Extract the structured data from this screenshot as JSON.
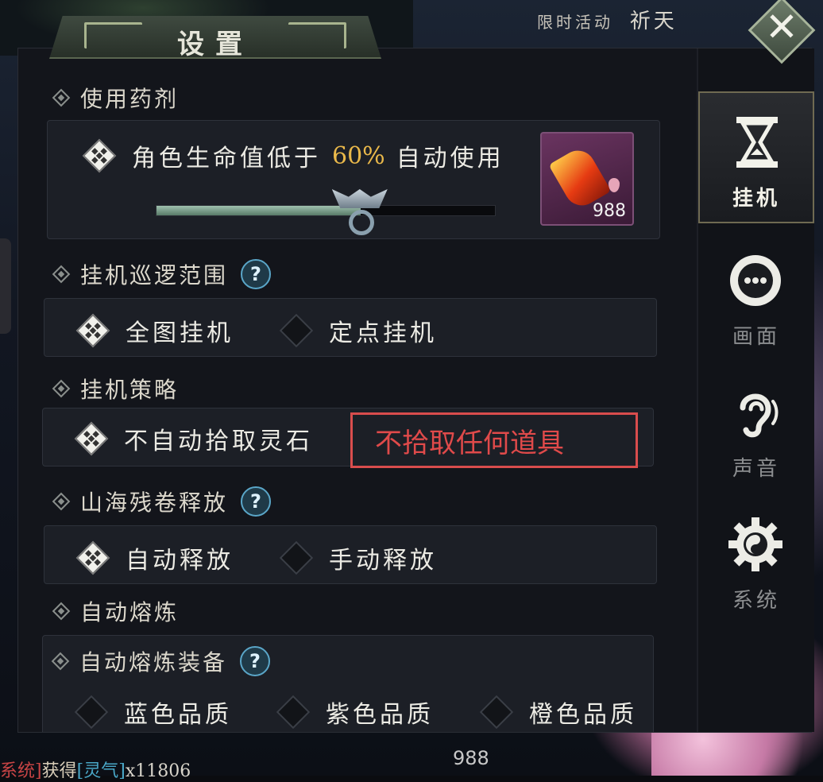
{
  "hud": {
    "label1": "限时活动",
    "label2": "祈天"
  },
  "window": {
    "title": "设置"
  },
  "close": {
    "glyph": "✕"
  },
  "sections": {
    "potion": {
      "header": "使用药剂",
      "label_prefix": "角色生命值低于",
      "percent": "60%",
      "label_suffix": "自动使用",
      "slider_value": 0.6,
      "item_count": "988"
    },
    "patrol": {
      "header": "挂机巡逻范围",
      "help": "?",
      "options": [
        {
          "label": "全图挂机",
          "selected": true
        },
        {
          "label": "定点挂机",
          "selected": false
        }
      ]
    },
    "strategy": {
      "header": "挂机策略",
      "option": {
        "label": "不自动拾取灵石",
        "selected": true
      },
      "annotation": "不拾取任何道具"
    },
    "scroll": {
      "header": "山海残卷释放",
      "help": "?",
      "options": [
        {
          "label": "自动释放",
          "selected": true
        },
        {
          "label": "手动释放",
          "selected": false
        }
      ]
    },
    "smelt": {
      "header": "自动熔炼",
      "sub_header": "自动熔炼装备",
      "help": "?",
      "options_partial": [
        "蓝色品质",
        "紫色品质",
        "橙色品质"
      ]
    }
  },
  "sidebar": {
    "tabs": [
      {
        "label": "挂机",
        "icon": "hourglass-icon",
        "active": true
      },
      {
        "label": "画面",
        "icon": "display-icon",
        "active": false
      },
      {
        "label": "声音",
        "icon": "ear-icon",
        "active": false
      },
      {
        "label": "系统",
        "icon": "gear-icon",
        "active": false
      }
    ]
  },
  "chat": {
    "channel": "系统",
    "verb": "获得",
    "item": "灵气",
    "amount": "x11806"
  },
  "bottom_count": "988",
  "colors": {
    "accent_gold": "#e9b84a",
    "annotation_red": "#d94d4d",
    "help_blue": "#5aa6c8"
  }
}
